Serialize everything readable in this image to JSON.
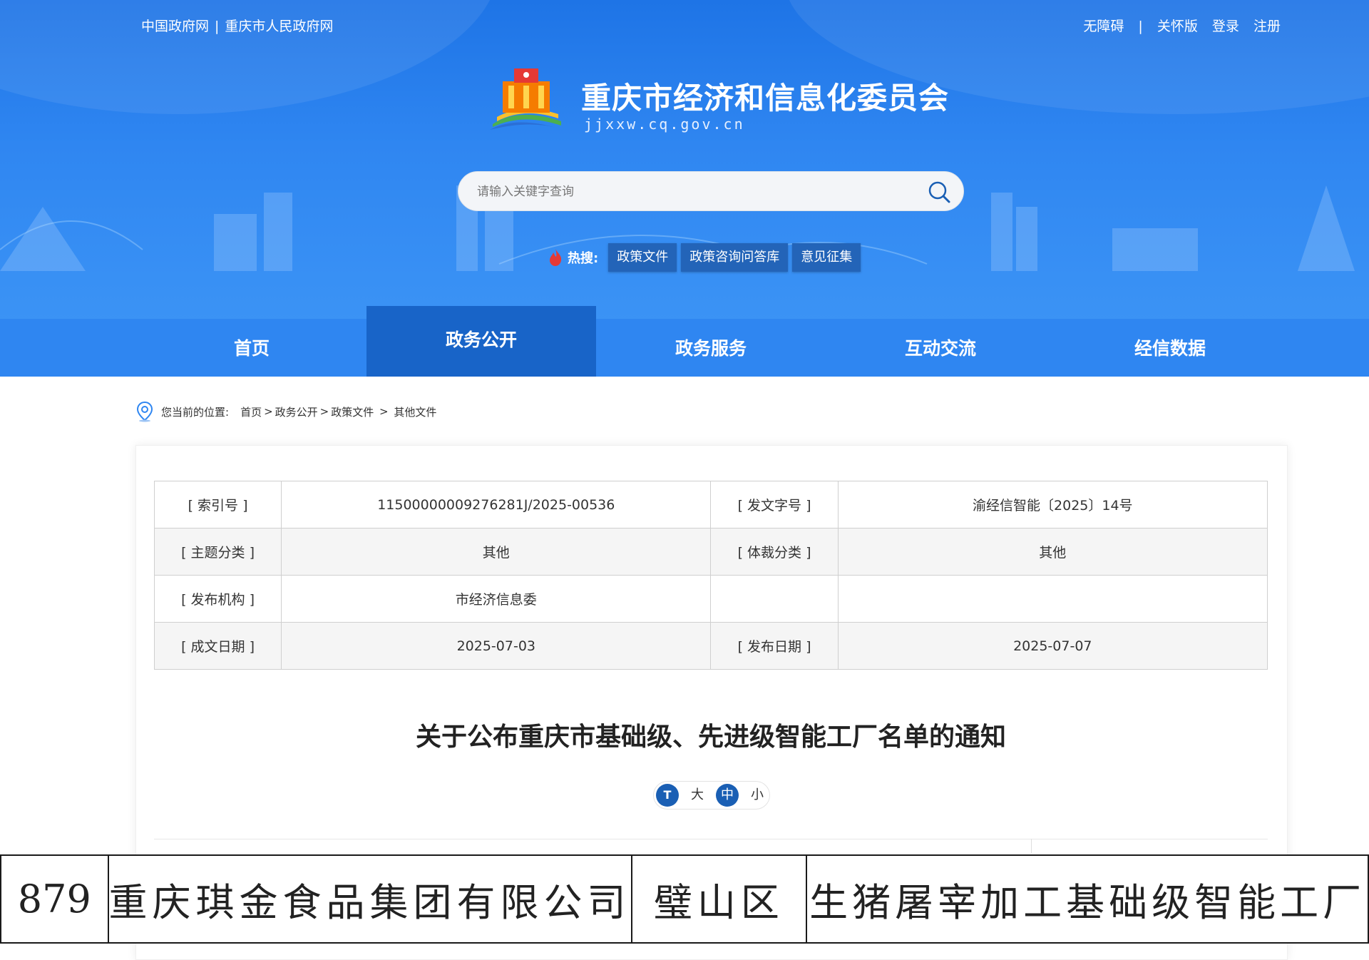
{
  "header": {
    "top_left_links": [
      "中国政府网",
      "重庆市人民政府网"
    ],
    "top_left_separator": "|",
    "top_right_links": [
      "无障碍",
      "|",
      "关怀版",
      "登录",
      "注册"
    ],
    "site_title": "重庆市经济和信息化委员会",
    "site_url": "jjxxw.cq.gov.cn",
    "search": {
      "placeholder": "请输入关键字查询",
      "icon": "search-icon"
    },
    "hot": {
      "label": "热搜:",
      "tags": [
        "政策文件",
        "政策咨询问答库",
        "意见征集"
      ],
      "icon": "flame-icon"
    },
    "nav": [
      "首页",
      "政务公开",
      "政务服务",
      "互动交流",
      "经信数据"
    ],
    "nav_active": "政务公开",
    "colors": {
      "header_blue": "#2f86f1",
      "nav_active": "#1864c8",
      "hot_tag": "#2364b8"
    }
  },
  "breadcrumb": {
    "label": "您当前的位置:",
    "items": [
      "首页",
      "政务公开",
      "政策文件",
      "其他文件"
    ],
    "separators": [
      ">",
      ">",
      " > "
    ]
  },
  "meta_table": [
    [
      "[ 索引号 ]",
      "11500000009276281J/2025-00536",
      "[ 发文字号 ]",
      "渝经信智能〔2025〕14号"
    ],
    [
      "[ 主题分类 ]",
      "其他",
      "[ 体裁分类 ]",
      "其他"
    ],
    [
      "[ 发布机构 ]",
      "市经济信息委",
      "",
      ""
    ],
    [
      "[ 成文日期 ]",
      "2025-07-03",
      "[ 发布日期 ]",
      "2025-07-07"
    ]
  ],
  "doc_title": "关于公布重庆市基础级、先进级智能工厂名单的通知",
  "font_size": {
    "icon_label": "T",
    "options": [
      "大",
      "中",
      "小"
    ],
    "selected": "中"
  },
  "excerpt_row": [
    "879",
    "重庆琪金食品集团有限公司",
    "璧山区",
    "生猪屠宰加工基础级智能工厂"
  ]
}
